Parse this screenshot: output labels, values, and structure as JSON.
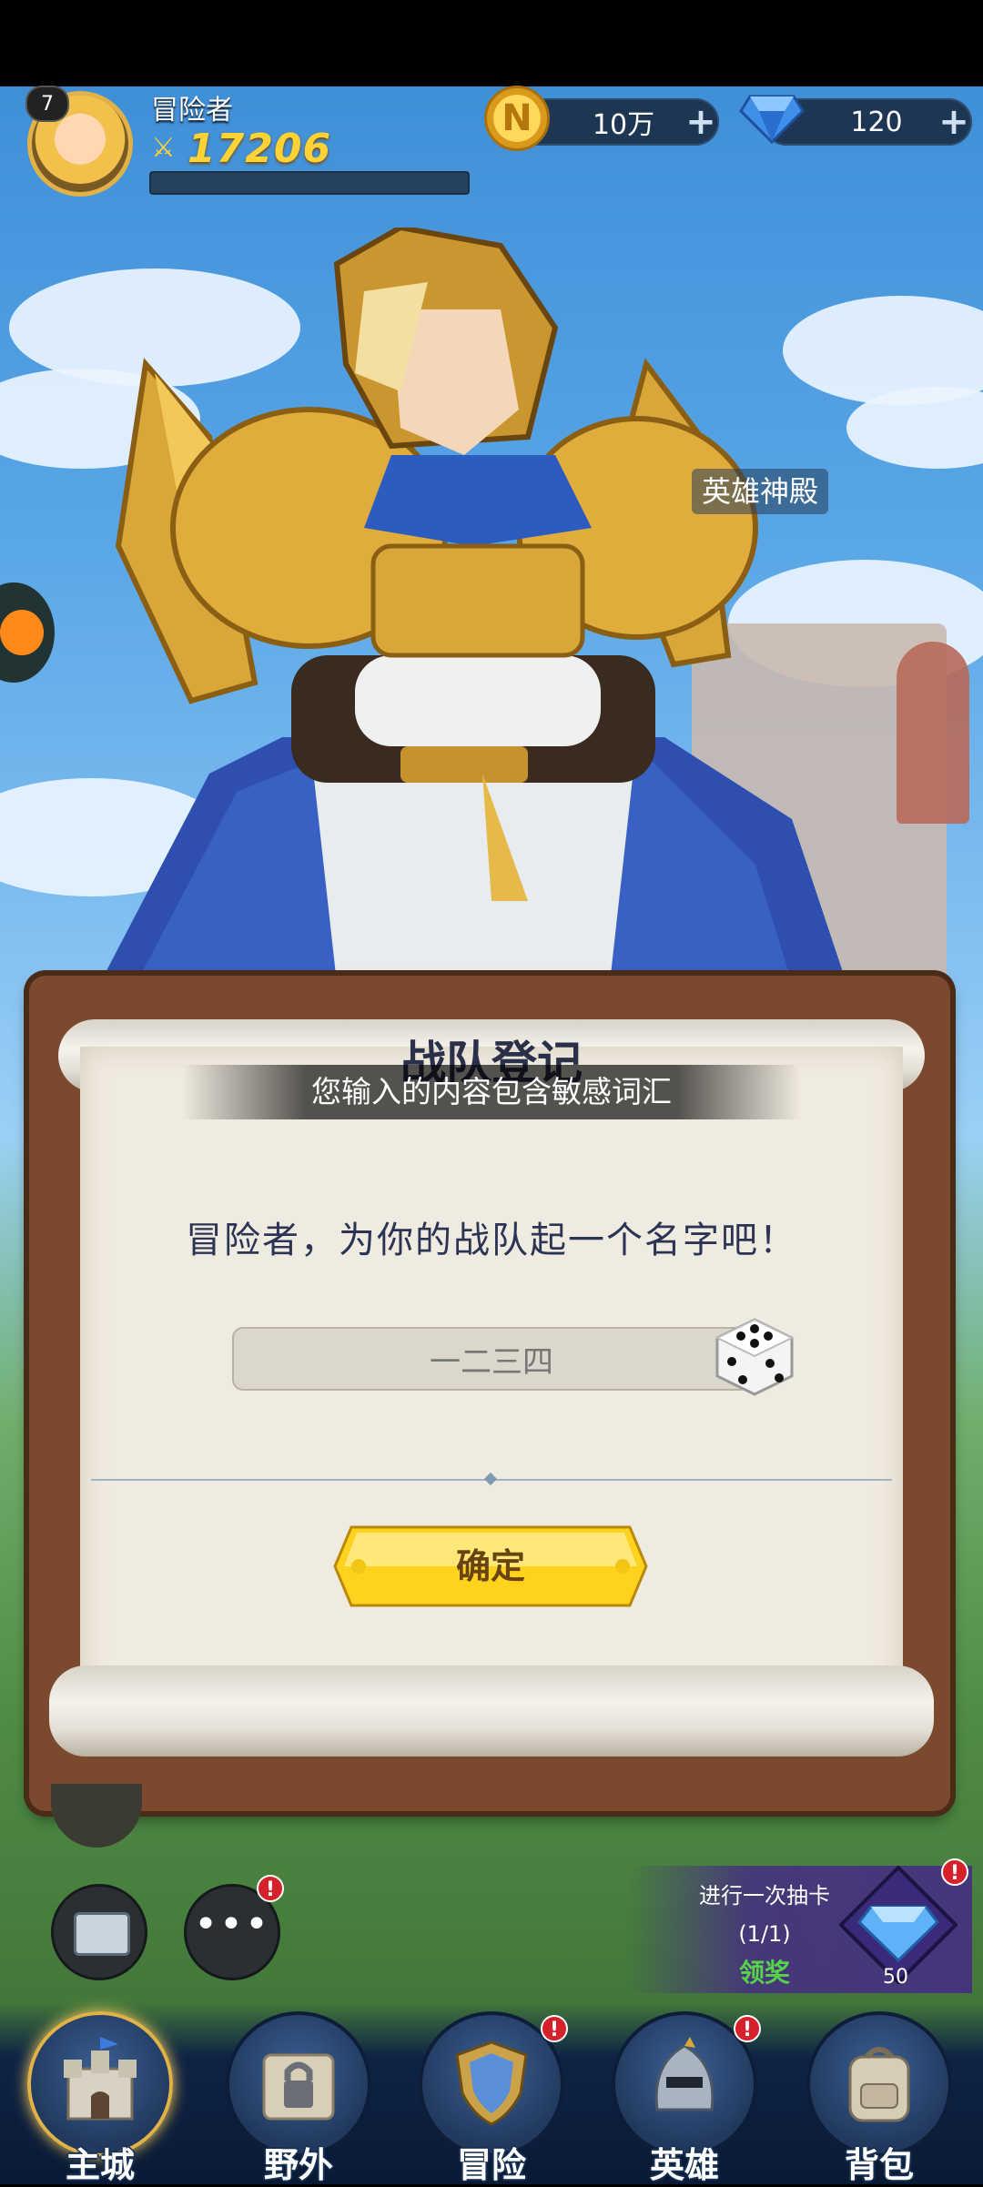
{
  "player": {
    "level": "7",
    "name": "冒险者",
    "power": "17206"
  },
  "currency": {
    "coins": "10万",
    "gems": "120"
  },
  "scene": {
    "temple_label": "英雄神殿"
  },
  "dialog": {
    "title": "战队登记",
    "toast": "您输入的内容包含敏感词汇",
    "prompt": "冒险者，为你的战队起一个名字吧！",
    "name_value": "一二三四",
    "confirm_label": "确定"
  },
  "draw": {
    "line1": "进行一次抽卡",
    "progress": "(1/1)",
    "claim": "领奖",
    "gem_count": "50"
  },
  "badges": {
    "mark": "!"
  },
  "nav": {
    "items": [
      {
        "label": "主城"
      },
      {
        "label": "野外"
      },
      {
        "label": "冒险"
      },
      {
        "label": "英雄"
      },
      {
        "label": "背包"
      }
    ]
  },
  "colors": {
    "accent": "#ffd335",
    "panel_wood": "#7b4a2e",
    "paper": "#f0ebe0",
    "confirm_yellow": "#ffd21e"
  }
}
